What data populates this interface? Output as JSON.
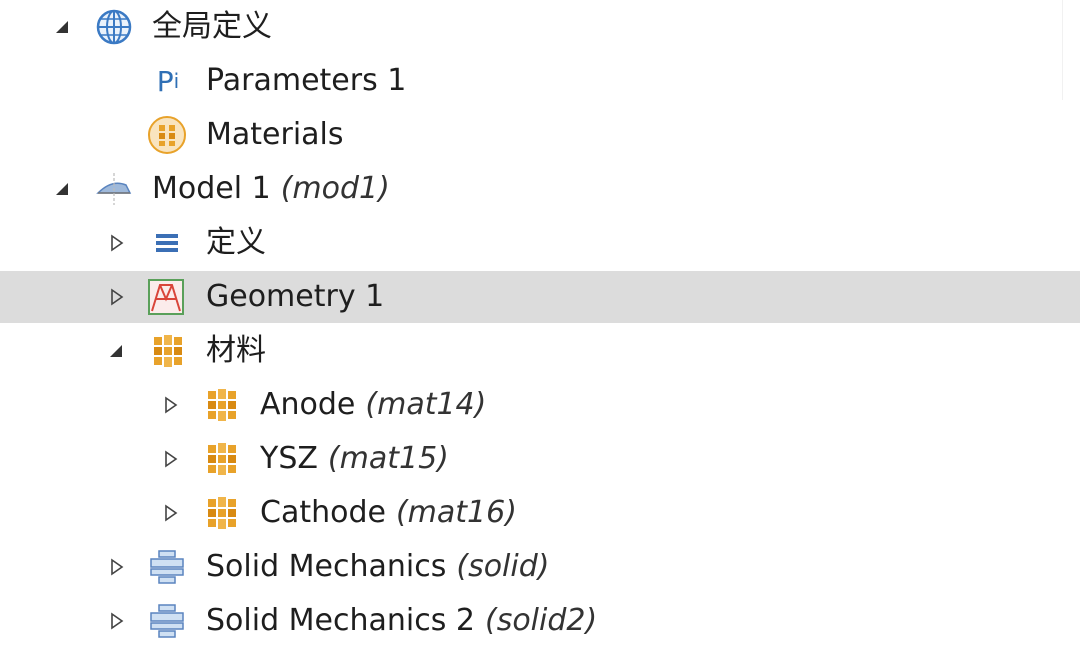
{
  "tree": {
    "items": [
      {
        "label": "全局定义",
        "tag": "",
        "icon": "globe-icon",
        "toggle": "expanded"
      },
      {
        "label": "Parameters 1",
        "tag": "",
        "icon": "parameters-icon",
        "toggle": "none"
      },
      {
        "label": "Materials",
        "tag": "",
        "icon": "materials-global-icon",
        "toggle": "none"
      },
      {
        "label": "Model 1",
        "tag": "(mod1)",
        "icon": "model-icon",
        "toggle": "expanded"
      },
      {
        "label": "定义",
        "tag": "",
        "icon": "definitions-icon",
        "toggle": "collapsed"
      },
      {
        "label": "Geometry 1",
        "tag": "",
        "icon": "geometry-icon",
        "toggle": "collapsed",
        "selected": true
      },
      {
        "label": "材料",
        "tag": "",
        "icon": "materials-icon",
        "toggle": "expanded"
      },
      {
        "label": "Anode",
        "tag": "(mat14)",
        "icon": "material-icon",
        "toggle": "collapsed"
      },
      {
        "label": "YSZ",
        "tag": "(mat15)",
        "icon": "material-icon",
        "toggle": "collapsed"
      },
      {
        "label": "Cathode",
        "tag": "(mat16)",
        "icon": "material-icon",
        "toggle": "collapsed"
      },
      {
        "label": "Solid Mechanics",
        "tag": "(solid)",
        "icon": "solid-mechanics-icon",
        "toggle": "collapsed"
      },
      {
        "label": "Solid Mechanics 2",
        "tag": "(solid2)",
        "icon": "solid-mechanics-icon",
        "toggle": "collapsed"
      }
    ],
    "param_icon_text": "P",
    "param_icon_sub": "i"
  },
  "colors": {
    "selected_row": "#dcdcdc",
    "material_orange": "#e8a22a",
    "globe_blue": "#3b7ac4",
    "mechanics_blue": "#6f9fd6",
    "geometry_red": "#d9453a",
    "geometry_green": "#5aa05a"
  }
}
